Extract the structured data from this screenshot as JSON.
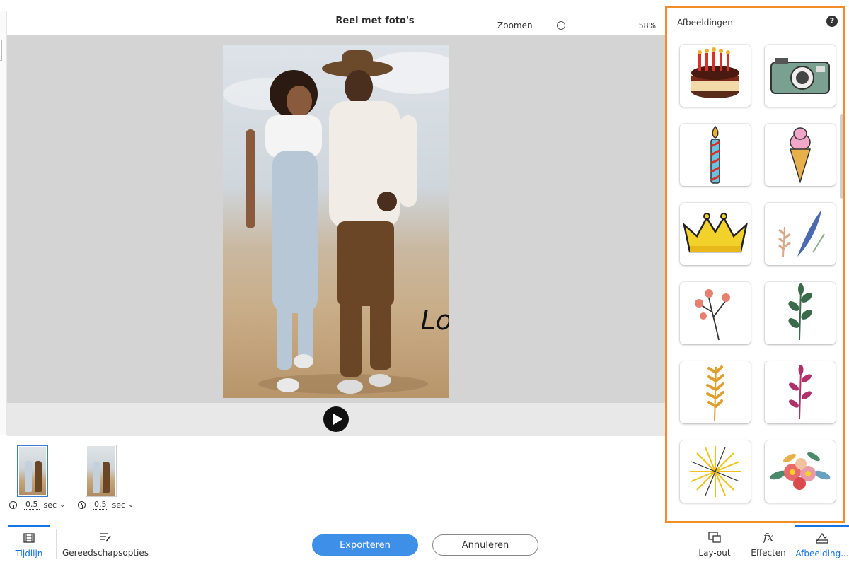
{
  "header": {
    "title": "Reel met foto's",
    "zoom_label": "Zoomen",
    "zoom_value": "58%",
    "zoom_level": 0.2
  },
  "canvas": {
    "overlay_text": "Lo"
  },
  "timeline": {
    "frames": [
      {
        "duration": "0.5",
        "unit": "sec",
        "selected": true
      },
      {
        "duration": "0.5",
        "unit": "sec",
        "selected": false
      }
    ]
  },
  "bottom_bar": {
    "timeline_label": "Tijdlijn",
    "tool_options_label": "Gereedschapsopties",
    "export_label": "Exporteren",
    "cancel_label": "Annuleren",
    "layout_label": "Lay-out",
    "effects_label": "Effecten",
    "images_label": "Afbeelding..."
  },
  "panel": {
    "title": "Afbeeldingen",
    "help": "?",
    "stickers": [
      "birthday-cake",
      "camera",
      "candle",
      "ice-cream",
      "crown",
      "feather-leaves",
      "berry-branch",
      "green-leaf",
      "yellow-wheat",
      "pink-branch",
      "fireworks",
      "flower-bouquet"
    ]
  },
  "colors": {
    "accent_blue": "#1473e6",
    "export_button": "#3d8fe8",
    "highlight_orange": "#f28c28"
  }
}
